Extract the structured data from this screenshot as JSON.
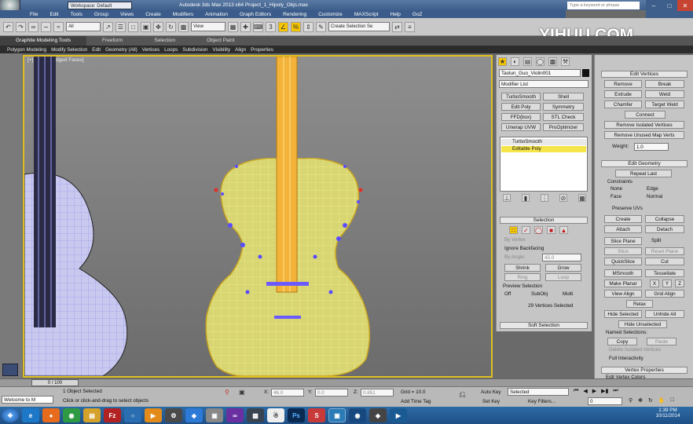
{
  "titlebar": {
    "workspace": "Workspace: Default",
    "app_title": "Autodesk 3ds Max 2013 x64     Project_1_Hipoly_Objs.max",
    "search_placeholder": "Type a keyword or phrase"
  },
  "menus": [
    "File",
    "Edit",
    "Tools",
    "Group",
    "Views",
    "Create",
    "Modifiers",
    "Animation",
    "Graph Editors",
    "Rendering",
    "Customize",
    "MAXScript",
    "Help",
    "GoZ"
  ],
  "toolbar": {
    "filter": "All",
    "view": "View",
    "selset": "Create Selection Se"
  },
  "watermark": "YIHUU.COM",
  "ribbon": {
    "tabs": [
      "Graphite Modeling Tools",
      "Freeform",
      "Selection",
      "Object Paint"
    ],
    "subtabs": [
      "Polygon Modeling",
      "Modify Selection",
      "Edit",
      "Geometry (All)",
      "Vertices",
      "Loops",
      "Subdivision",
      "Visibility",
      "Align",
      "Properties"
    ]
  },
  "viewport": {
    "label": "[+] [Front] [Edged Faces]"
  },
  "cmdpanel": {
    "object_name": "Taolun_Guo_Violin001",
    "modifier_list": "Modifier List",
    "mod_buttons": [
      "TurboSmooth",
      "Shell",
      "Edit Poly",
      "Symmetry",
      "FFD(box)",
      "STL Check",
      "Unwrap UVW",
      "ProOptimizer"
    ],
    "stack": [
      "TurboSmooth",
      "Editable Poly"
    ],
    "selection": {
      "header": "Selection",
      "by_vertex": "By Vertex",
      "ignore_backfacing": "Ignore Backfacing",
      "by_angle": "By Angle:",
      "angle_value": "45.0",
      "shrink": "Shrink",
      "grow": "Grow",
      "ring": "Ring",
      "loop": "Loop",
      "preview": "Preview Selection",
      "off": "Off",
      "subobj": "SubObj",
      "multi": "Multi",
      "status": "29 Vertices Selected",
      "soft": "Soft Selection"
    }
  },
  "rightpanel": {
    "edit_vertices": {
      "header": "Edit Vertices",
      "remove": "Remove",
      "break": "Break",
      "extrude": "Extrude",
      "weld": "Weld",
      "chamfer": "Chamfer",
      "target_weld": "Target Weld",
      "connect": "Connect",
      "remove_isolated": "Remove Isolated Vertices",
      "remove_unused": "Remove Unused Map Verts",
      "weight_label": "Weight:",
      "weight_value": "1.0"
    },
    "edit_geometry": {
      "header": "Edit Geometry",
      "repeat_last": "Repeat Last",
      "constraints": "Constraints",
      "none": "None",
      "edge": "Edge",
      "face": "Face",
      "normal": "Normal",
      "preserve_uvs": "Preserve UVs",
      "create": "Create",
      "collapse": "Collapse",
      "attach": "Attach",
      "detach": "Detach",
      "slice_plane": "Slice Plane",
      "split": "Split",
      "slice": "Slice",
      "reset_plane": "Reset Plane",
      "quickslice": "QuickSlice",
      "cut": "Cut",
      "msmooth": "MSmooth",
      "tessellate": "Tessellate",
      "make_planar": "Make Planar",
      "x": "X",
      "y": "Y",
      "z": "Z",
      "view_align": "View Align",
      "grid_align": "Grid Align",
      "relax": "Relax",
      "hide_selected": "Hide Selected",
      "unhide_all": "Unhide All",
      "hide_unselected": "Hide Unselected",
      "named_selections": "Named Selections:",
      "copy": "Copy",
      "paste": "Paste",
      "delete_isolated": "Delete Isolated Vertices",
      "full_interactivity": "Full Interactivity"
    },
    "vertex_properties": "Vertex Properties",
    "edit_vertex_colors": "Edit Vertex Colors"
  },
  "timeline": {
    "frame": "0 / 100"
  },
  "status": {
    "maxscript": "Welcome to M",
    "objects": "1 Object Selected",
    "prompt": "Click or click-and-drag to select objects",
    "x_label": "X:",
    "x": "46.0",
    "y_label": "Y:",
    "y": "0.0",
    "z_label": "Z:",
    "z": "0.851",
    "grid": "Grid = 10.0",
    "add_time_tag": "Add Time Tag",
    "auto_key": "Auto Key",
    "set_key": "Set Key",
    "selected": "Selected",
    "key_filters": "Key Filters...",
    "frame_value": "0"
  },
  "clock": {
    "time": "1:39 PM",
    "date": "10/11/2014"
  },
  "colors": {
    "selection_yellow": "#f5e44a",
    "viewport_border": "#e0c020",
    "close": "#c84432"
  }
}
